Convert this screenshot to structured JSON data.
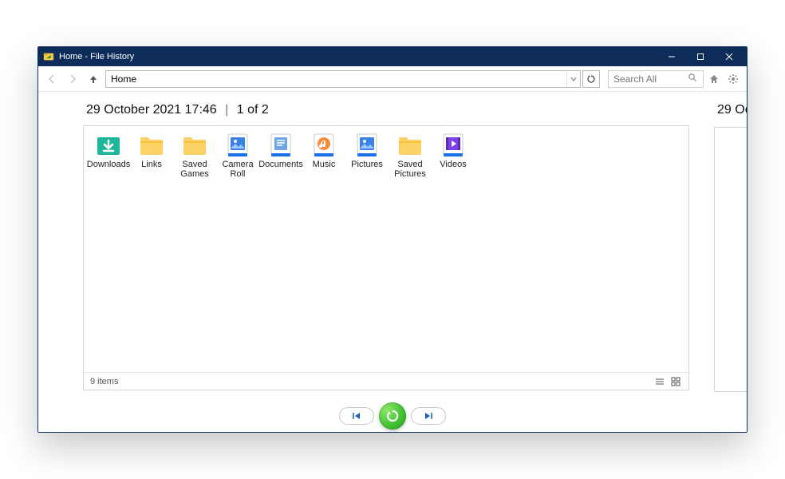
{
  "window": {
    "title": "Home - File History"
  },
  "toolbar": {
    "address": "Home",
    "search_placeholder": "Search All"
  },
  "page": {
    "timestamp": "29 October 2021 17:46",
    "position": "1 of 2",
    "next_timestamp_peek": "29 Oc"
  },
  "items": [
    {
      "label": "Downloads",
      "icon": "folder-downloads"
    },
    {
      "label": "Links",
      "icon": "folder"
    },
    {
      "label": "Saved Games",
      "icon": "folder"
    },
    {
      "label": "Camera Roll",
      "icon": "library-pictures"
    },
    {
      "label": "Documents",
      "icon": "library-documents"
    },
    {
      "label": "Music",
      "icon": "library-music"
    },
    {
      "label": "Pictures",
      "icon": "library-pictures"
    },
    {
      "label": "Saved Pictures",
      "icon": "folder"
    },
    {
      "label": "Videos",
      "icon": "library-videos"
    }
  ],
  "status": {
    "count_text": "9 items"
  }
}
